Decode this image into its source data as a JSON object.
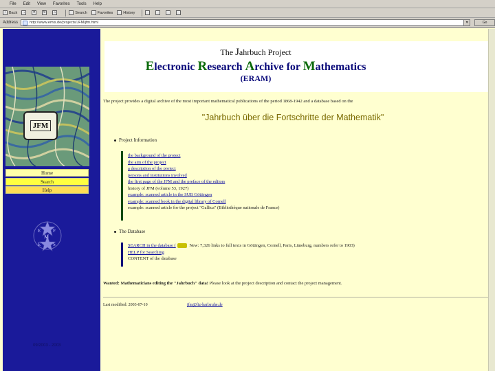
{
  "browser": {
    "menu": [
      "File",
      "Edit",
      "View",
      "Favorites",
      "Tools",
      "Help"
    ],
    "toolbar": {
      "back": "Back",
      "forward": "→",
      "stop": "✕",
      "refresh": "↻",
      "home": "⌂",
      "search": "Search",
      "favorites": "Favorites",
      "history": "History"
    },
    "address_label": "Address",
    "address_value": "http://www.emis.de/projects/JFM/jfm.html",
    "go_label": "Go"
  },
  "left_nav": {
    "logo_text": "JFM",
    "home": "Home",
    "search": "Search",
    "help": "Help",
    "efm_letters": [
      "E",
      "F",
      "M",
      "E",
      "S"
    ],
    "footer": "09/2003 - 2003"
  },
  "header": {
    "project_line_pre": "The ",
    "project_line_j": "J",
    "project_line_post": "ahrbuch Project",
    "eram_e": "E",
    "eram_e_rest": "lectronic ",
    "eram_r": "R",
    "eram_r_rest": "esearch ",
    "eram_a": "A",
    "eram_a_rest": "rchive for ",
    "eram_m": "M",
    "eram_m_rest": "athematics",
    "eram_abbr": "(ERAM)"
  },
  "intro": "The project provides a digital archive of the most important mathematical publications of the period 1868-1942 and a database based on the",
  "jahrbuch_title": "\"Jahrbuch über die Fortschritte der Mathematik\"",
  "sections": {
    "project_info": "Project Information",
    "database": "The Database"
  },
  "project_links": [
    {
      "text": "the background of the project",
      "link": true
    },
    {
      "text": "the aim of the project",
      "link": true
    },
    {
      "text": "a description of the project",
      "link": true
    },
    {
      "text": "persons and institutions involved",
      "link": true
    },
    {
      "text": "the first page of the JFM and the preface of the editors",
      "link": true
    },
    {
      "text": "history of JFM (volume 53, 1927)",
      "link": false
    },
    {
      "text": "example: scanned article in the SUB Göttingen",
      "link": true
    },
    {
      "text": "example: scanned book in the digital library of Cornell",
      "link": true
    },
    {
      "text": "example: scanned article for the project \"Gallica\" (Bibliothèque nationale de France)",
      "link": false
    }
  ],
  "db_links": {
    "search_pre": "SEARCH in the database (",
    "search_post": " New: 7,326 links to full texts in Göttingen, Cornell, Paris, Lüneburg, numbers refer to 1903)",
    "help": "HELP for Searching",
    "content": "CONTENT of the database"
  },
  "wanted": {
    "bold": "Wanted: Mathematicians editing the \"Jahrbuch\" data!",
    "rest": " Please look at the project description and contact the project management."
  },
  "footer": {
    "last_modified": "Last modified: 2003-07-10",
    "contact": "jfm@fiz-karlsruhe.de"
  }
}
